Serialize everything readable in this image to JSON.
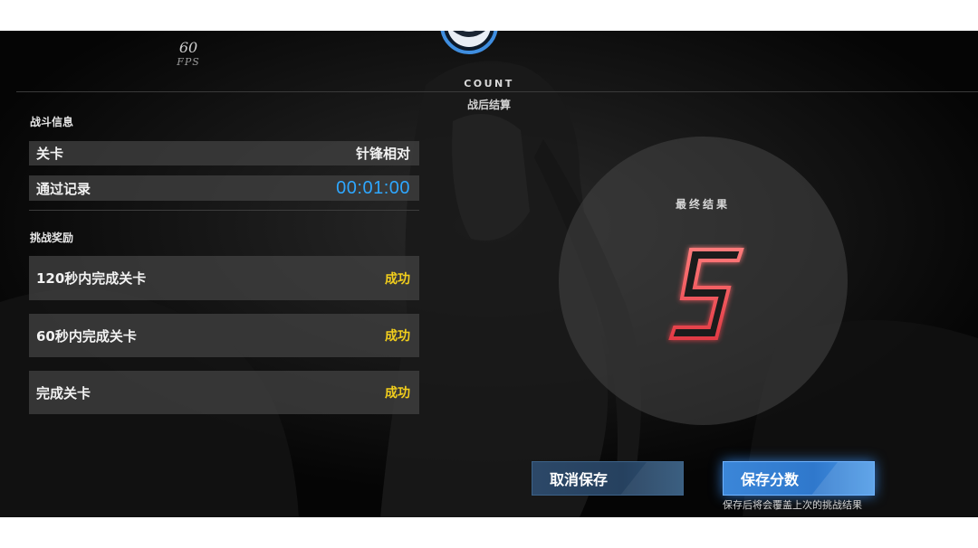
{
  "hud": {
    "fps_value": "60",
    "fps_unit": "FPS"
  },
  "header": {
    "title": "COUNT",
    "subtitle": "战后结算"
  },
  "battle_info": {
    "section_title": "战斗信息",
    "rows": [
      {
        "label": "关卡",
        "value": "针锋相对"
      },
      {
        "label": "通过记录",
        "value": "00:01:00"
      }
    ]
  },
  "challenge_rewards": {
    "section_title": "挑战奖励",
    "items": [
      {
        "label": "120秒内完成关卡",
        "status": "成功"
      },
      {
        "label": "60秒内完成关卡",
        "status": "成功"
      },
      {
        "label": "完成关卡",
        "status": "成功"
      }
    ]
  },
  "result": {
    "label": "最终结果",
    "score": "5"
  },
  "buttons": {
    "cancel": "取消保存",
    "save": "保存分数"
  },
  "save_note": "保存后将会覆盖上次的挑战结果",
  "colors": {
    "time_blue": "#2ea7ff",
    "success_yellow": "#f3cf1c",
    "score_red": "#ff5a5f",
    "accent_blue": "#3b86d8"
  },
  "icons": {
    "emblem": "emblem-icon"
  }
}
